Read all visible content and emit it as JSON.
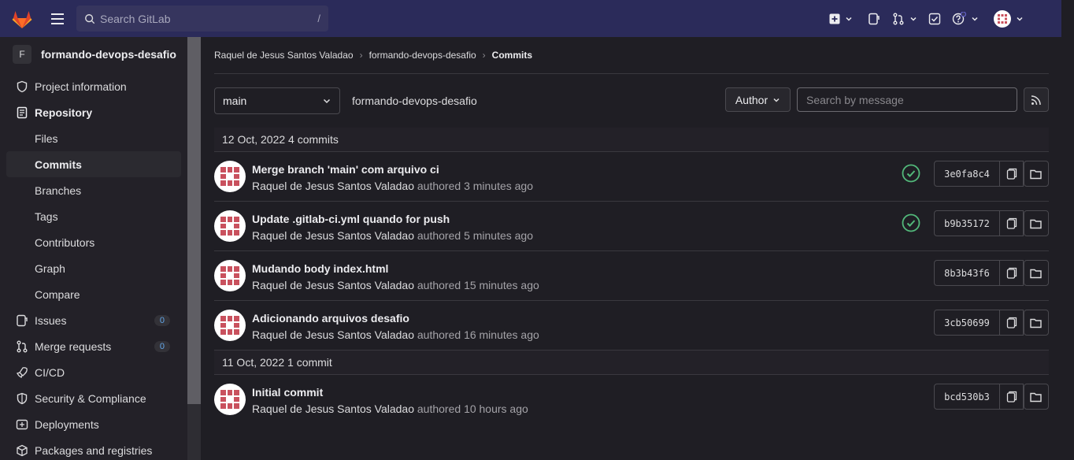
{
  "topbar": {
    "search_placeholder": "Search GitLab",
    "search_shortcut": "/"
  },
  "sidebar": {
    "project_initial": "F",
    "project_name": "formando-devops-desafio",
    "items": [
      {
        "label": "Project information"
      },
      {
        "label": "Repository"
      },
      {
        "label": "Files"
      },
      {
        "label": "Commits"
      },
      {
        "label": "Branches"
      },
      {
        "label": "Tags"
      },
      {
        "label": "Contributors"
      },
      {
        "label": "Graph"
      },
      {
        "label": "Compare"
      },
      {
        "label": "Issues",
        "count": "0"
      },
      {
        "label": "Merge requests",
        "count": "0"
      },
      {
        "label": "CI/CD"
      },
      {
        "label": "Security & Compliance"
      },
      {
        "label": "Deployments"
      },
      {
        "label": "Packages and registries"
      }
    ]
  },
  "breadcrumb": {
    "user": "Raquel de Jesus Santos Valadao",
    "project": "formando-devops-desafio",
    "current": "Commits"
  },
  "filters": {
    "branch": "main",
    "project_path": "formando-devops-desafio",
    "author_label": "Author",
    "search_placeholder": "Search by message"
  },
  "groups": [
    {
      "header": "12 Oct, 2022 4 commits",
      "commits": [
        {
          "title": "Merge branch 'main' com arquivo ci",
          "author": "Raquel de Jesus Santos Valadao",
          "verb": "authored",
          "time": "3 minutes ago",
          "sha": "3e0fa8c4",
          "status": "passed"
        },
        {
          "title": "Update .gitlab-ci.yml quando for push",
          "author": "Raquel de Jesus Santos Valadao",
          "verb": "authored",
          "time": "5 minutes ago",
          "sha": "b9b35172",
          "status": "passed"
        },
        {
          "title": "Mudando body index.html",
          "author": "Raquel de Jesus Santos Valadao",
          "verb": "authored",
          "time": "15 minutes ago",
          "sha": "8b3b43f6",
          "status": ""
        },
        {
          "title": "Adicionando arquivos desafio",
          "author": "Raquel de Jesus Santos Valadao",
          "verb": "authored",
          "time": "16 minutes ago",
          "sha": "3cb50699",
          "status": ""
        }
      ]
    },
    {
      "header": "11 Oct, 2022 1 commit",
      "commits": [
        {
          "title": "Initial commit",
          "author": "Raquel de Jesus Santos Valadao",
          "verb": "authored",
          "time": "10 hours ago",
          "sha": "bcd530b3",
          "status": ""
        }
      ]
    }
  ],
  "colors": {
    "navbar": "#2b2b5a",
    "success": "#52b87a",
    "avatar_pattern": "#c9515e"
  }
}
